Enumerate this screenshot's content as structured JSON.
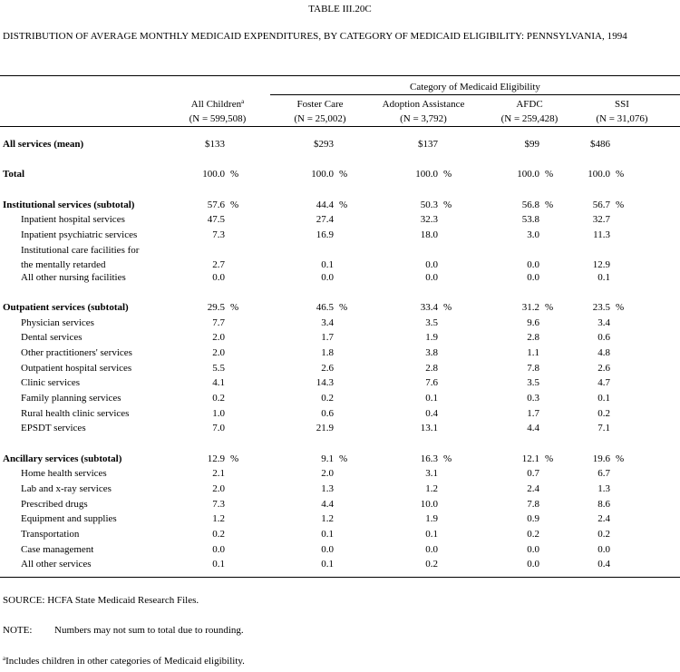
{
  "title": "TABLE III.20C",
  "subtitle": "DISTRIBUTION OF AVERAGE MONTHLY MEDICAID EXPENDITURES, BY CATEGORY OF MEDICAID ELIGIBILITY: PENNSYLVANIA, 1994",
  "header": {
    "group_label": "Category of Medicaid Eligibility",
    "columns": [
      {
        "label": "All Children",
        "footnote_mark": "a",
        "n": "(N = 599,508)"
      },
      {
        "label": "Foster Care",
        "n": "(N = 25,002)"
      },
      {
        "label": "Adoption Assistance",
        "n": "(N = 3,792)"
      },
      {
        "label": "AFDC",
        "n": "(N = 259,428)"
      },
      {
        "label": "SSI",
        "n": "(N = 31,076)"
      }
    ]
  },
  "rows": [
    {
      "label": "All services (mean)",
      "bold": true,
      "values": [
        "$133",
        "$293",
        "$137",
        "$99",
        "$486"
      ],
      "pct": false
    },
    {
      "label": "Total",
      "bold": true,
      "values": [
        "100.0",
        "100.0",
        "100.0",
        "100.0",
        "100.0"
      ],
      "pct": true
    },
    {
      "label": "Institutional services (subtotal)",
      "bold": true,
      "values": [
        "57.6",
        "44.4",
        "50.3",
        "56.8",
        "56.7"
      ],
      "pct": true
    },
    {
      "label": "Inpatient hospital services",
      "values": [
        "47.5",
        "27.4",
        "32.3",
        "53.8",
        "32.7"
      ]
    },
    {
      "label": "Inpatient psychiatric services",
      "values": [
        "7.3",
        "16.9",
        "18.0",
        "3.0",
        "11.3"
      ]
    },
    {
      "label": "Institutional care facilities for",
      "label2": "the mentally retarded",
      "values": [
        "2.7",
        "0.1",
        "0.0",
        "0.0",
        "12.9"
      ]
    },
    {
      "label": "All other nursing facilities",
      "values": [
        "0.0",
        "0.0",
        "0.0",
        "0.0",
        "0.1"
      ]
    },
    {
      "label": "Outpatient services (subtotal)",
      "bold": true,
      "values": [
        "29.5",
        "46.5",
        "33.4",
        "31.2",
        "23.5"
      ],
      "pct": true
    },
    {
      "label": "Physician services",
      "values": [
        "7.7",
        "3.4",
        "3.5",
        "9.6",
        "3.4"
      ]
    },
    {
      "label": "Dental services",
      "values": [
        "2.0",
        "1.7",
        "1.9",
        "2.8",
        "0.6"
      ]
    },
    {
      "label": "Other practitioners' services",
      "values": [
        "2.0",
        "1.8",
        "3.8",
        "1.1",
        "4.8"
      ]
    },
    {
      "label": "Outpatient hospital services",
      "values": [
        "5.5",
        "2.6",
        "2.8",
        "7.8",
        "2.6"
      ]
    },
    {
      "label": "Clinic services",
      "values": [
        "4.1",
        "14.3",
        "7.6",
        "3.5",
        "4.7"
      ]
    },
    {
      "label": "Family planning services",
      "values": [
        "0.2",
        "0.2",
        "0.1",
        "0.3",
        "0.1"
      ]
    },
    {
      "label": "Rural health clinic services",
      "values": [
        "1.0",
        "0.6",
        "0.4",
        "1.7",
        "0.2"
      ]
    },
    {
      "label": "EPSDT services",
      "values": [
        "7.0",
        "21.9",
        "13.1",
        "4.4",
        "7.1"
      ]
    },
    {
      "label": "Ancillary services (subtotal)",
      "bold": true,
      "values": [
        "12.9",
        "9.1",
        "16.3",
        "12.1",
        "19.6"
      ],
      "pct": true
    },
    {
      "label": "Home health services",
      "values": [
        "2.1",
        "2.0",
        "3.1",
        "0.7",
        "6.7"
      ]
    },
    {
      "label": "Lab and x-ray services",
      "values": [
        "2.0",
        "1.3",
        "1.2",
        "2.4",
        "1.3"
      ]
    },
    {
      "label": "Prescribed drugs",
      "values": [
        "7.3",
        "4.4",
        "10.0",
        "7.8",
        "8.6"
      ]
    },
    {
      "label": "Equipment and supplies",
      "values": [
        "1.2",
        "1.2",
        "1.9",
        "0.9",
        "2.4"
      ]
    },
    {
      "label": "Transportation",
      "values": [
        "0.2",
        "0.1",
        "0.1",
        "0.2",
        "0.2"
      ]
    },
    {
      "label": "Case management",
      "values": [
        "0.0",
        "0.0",
        "0.0",
        "0.0",
        "0.0"
      ]
    },
    {
      "label": "All other services",
      "values": [
        "0.1",
        "0.1",
        "0.2",
        "0.0",
        "0.4"
      ]
    }
  ],
  "pct_symbol": "%",
  "footer": {
    "source": "SOURCE:  HCFA State Medicaid Research Files.",
    "note_label": "NOTE:",
    "note_text": "Numbers may not sum to total due to rounding.",
    "footnote_mark": "a",
    "footnote_text": "Includes children in other categories of Medicaid eligibility."
  }
}
